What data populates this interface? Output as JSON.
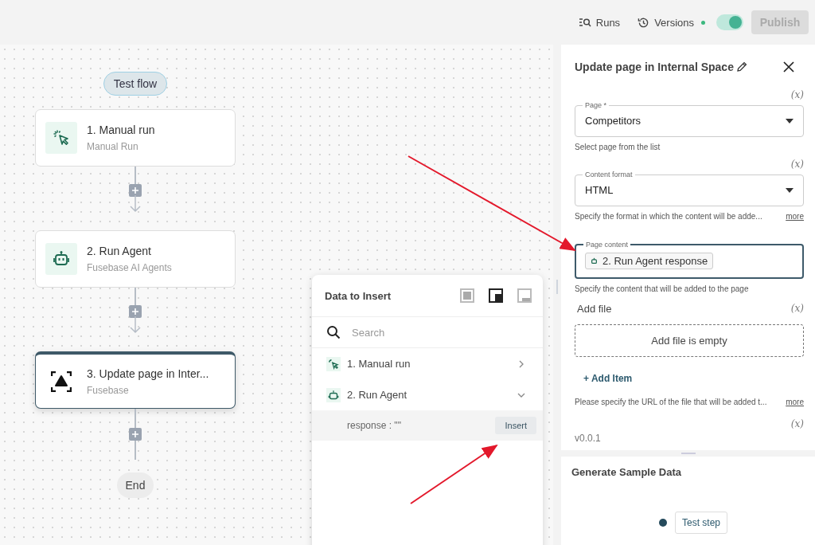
{
  "toolbar": {
    "runs": "Runs",
    "versions": "Versions",
    "has_changes": true,
    "live_toggle": {
      "on": true
    },
    "publish": {
      "label": "Publish",
      "disabled": true
    }
  },
  "flow": {
    "test_button": "Test flow",
    "nodes": [
      {
        "kind": "trigger",
        "title": "1. Manual run",
        "subtitle": "Manual Run",
        "selected": false
      },
      {
        "kind": "agent",
        "title": "2. Run Agent",
        "subtitle": "Fusebase AI Agents",
        "selected": false
      },
      {
        "kind": "fusebase",
        "title": "3. Update page in Inter...",
        "subtitle": "Fusebase",
        "selected": true
      }
    ],
    "end": "End"
  },
  "insert_popup": {
    "title": "Data to Insert",
    "layout_modes": [
      {
        "kind": "full",
        "selected": false
      },
      {
        "kind": "corner",
        "selected": true
      },
      {
        "kind": "docked",
        "selected": false
      }
    ],
    "search_placeholder": "Search",
    "items": [
      {
        "kind": "trigger",
        "label": "1. Manual run",
        "expanded": false
      },
      {
        "kind": "agent",
        "label": "2. Run Agent",
        "expanded": true,
        "children": [
          {
            "label": "response : \"\"",
            "action": "Insert"
          }
        ]
      }
    ]
  },
  "panel": {
    "title": "Update page in Internal Space",
    "fields": [
      {
        "kind": "select",
        "var": "(x)",
        "label": "Page *",
        "value": "Competitors",
        "hint": "Select page from the list",
        "focused": false
      },
      {
        "kind": "select",
        "var": "(x)",
        "label": "Content format",
        "value": "HTML",
        "hint": "Specify the format in which the content will be adde...",
        "more": "more",
        "focused": false
      },
      {
        "kind": "chip",
        "label": "Page content",
        "value": "2. Run Agent response",
        "hint": "Specify the content that will be added to the page",
        "focused": true
      }
    ],
    "add_file": {
      "label": "Add file",
      "var": "(x)",
      "empty": "Add file is empty",
      "add_item": "+ Add Item",
      "hint": "Please specify the URL of the file that will be added t...",
      "more": "more"
    },
    "trailing_var": "(x)",
    "version": "v0.0.1"
  },
  "sample": {
    "title": "Generate Sample Data",
    "test_button": "Test step"
  }
}
